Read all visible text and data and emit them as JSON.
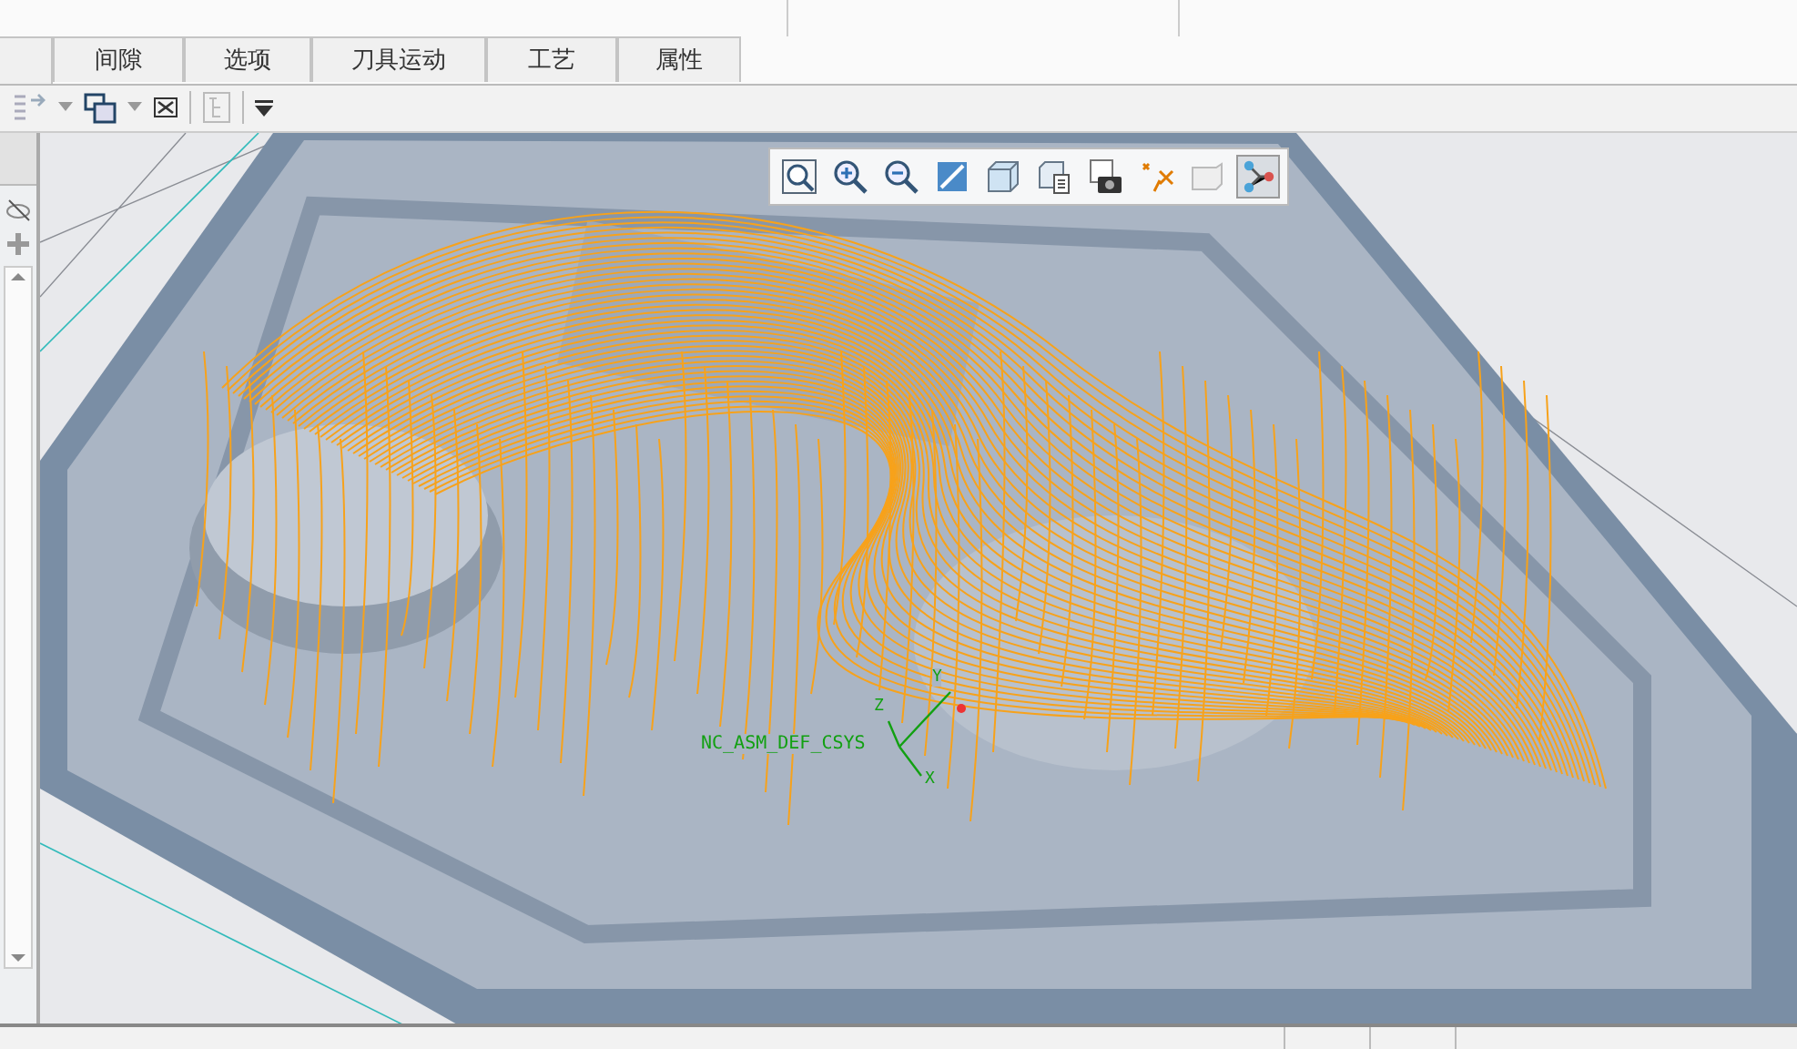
{
  "tabs": [
    {
      "label": "间隙",
      "selected": false
    },
    {
      "label": "选项",
      "selected": false
    },
    {
      "label": "刀具运动",
      "selected": false
    },
    {
      "label": "工艺",
      "selected": false
    },
    {
      "label": "属性",
      "selected": false
    }
  ],
  "feature_toolbar": [
    {
      "kind": "move"
    },
    {
      "kind": "caret"
    },
    {
      "kind": "frame"
    },
    {
      "kind": "caret"
    },
    {
      "kind": "close"
    },
    {
      "kind": "tree"
    },
    {
      "kind": "menu"
    }
  ],
  "view_toolbar": [
    {
      "kind": "zoom-fit",
      "selected": false
    },
    {
      "kind": "zoom-in",
      "selected": false
    },
    {
      "kind": "zoom-out",
      "selected": false
    },
    {
      "kind": "repaint",
      "selected": false
    },
    {
      "kind": "cube",
      "selected": false
    },
    {
      "kind": "views",
      "selected": false
    },
    {
      "kind": "camera",
      "selected": false
    },
    {
      "kind": "datum",
      "selected": false
    },
    {
      "kind": "note",
      "selected": false
    },
    {
      "kind": "path",
      "selected": true
    }
  ],
  "viewport": {
    "csys_label": "NC_ASM_DEF_CSYS",
    "axes": [
      "Z",
      "Y",
      "X"
    ]
  }
}
